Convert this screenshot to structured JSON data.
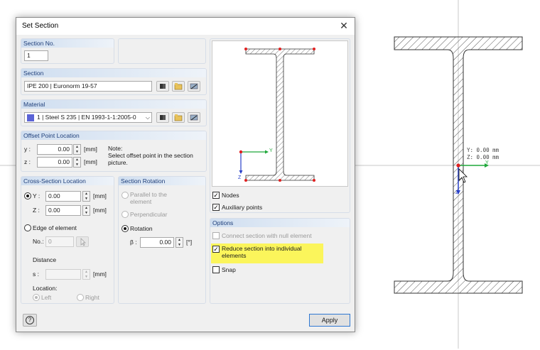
{
  "dialog": {
    "title": "Set Section",
    "close_glyph": "✕"
  },
  "section_no": {
    "header": "Section No.",
    "value": "1"
  },
  "section": {
    "header": "Section",
    "value": "IPE 200 | Euronorm 19-57"
  },
  "material": {
    "header": "Material",
    "value": "1  |  Steel S 235  |  EN 1993-1-1:2005-0",
    "swatch_color": "#5a63d6"
  },
  "offset": {
    "header": "Offset Point Location",
    "y_label": "y :",
    "y_value": "0.00",
    "y_unit": "[mm]",
    "z_label": "z :",
    "z_value": "0.00",
    "z_unit": "[mm]",
    "note": "Note:\nSelect offset point in the section\npicture."
  },
  "cross_section": {
    "header": "Cross-Section Location",
    "y_label": "Y :",
    "y_value": "0.00",
    "y_unit": "[mm]",
    "z_label": "Z :",
    "z_value": "0.00",
    "z_unit": "[mm]",
    "edge_label": "Edge of element",
    "no_label": "No.:",
    "no_value": "0",
    "distance_label": "Distance",
    "s_label": "s :",
    "s_unit": "[mm]",
    "location_label": "Location:",
    "left_label": "Left",
    "right_label": "Right"
  },
  "rotation": {
    "header": "Section Rotation",
    "parallel_label": "Parallel to the\nelement",
    "perpendicular_label": "Perpendicular",
    "rotation_label": "Rotation",
    "beta_label": "β :",
    "beta_value": "0.00",
    "beta_unit": "[°]"
  },
  "preview": {
    "y_axis": "Y",
    "z_axis": "Z",
    "nodes_label": "Nodes",
    "aux_label": "Auxiliary points"
  },
  "options": {
    "header": "Options",
    "connect_label": "Connect section with null element",
    "reduce_label": "Reduce section into individual\nelements",
    "snap_label": "Snap"
  },
  "footer": {
    "apply_label": "Apply",
    "help_glyph": "?"
  },
  "canvas": {
    "y_readout": "Y: 0.00 mm",
    "z_readout": "Z: 0.00 mm",
    "y_axis": "Y",
    "z_axis": "Z"
  },
  "colors": {
    "accent": "#2f78d2",
    "group_header": "#1f3f7a",
    "highlight": "#fbf55b",
    "node_red": "#e02020",
    "axis_green": "#1fa83a",
    "axis_blue": "#2840c8"
  }
}
